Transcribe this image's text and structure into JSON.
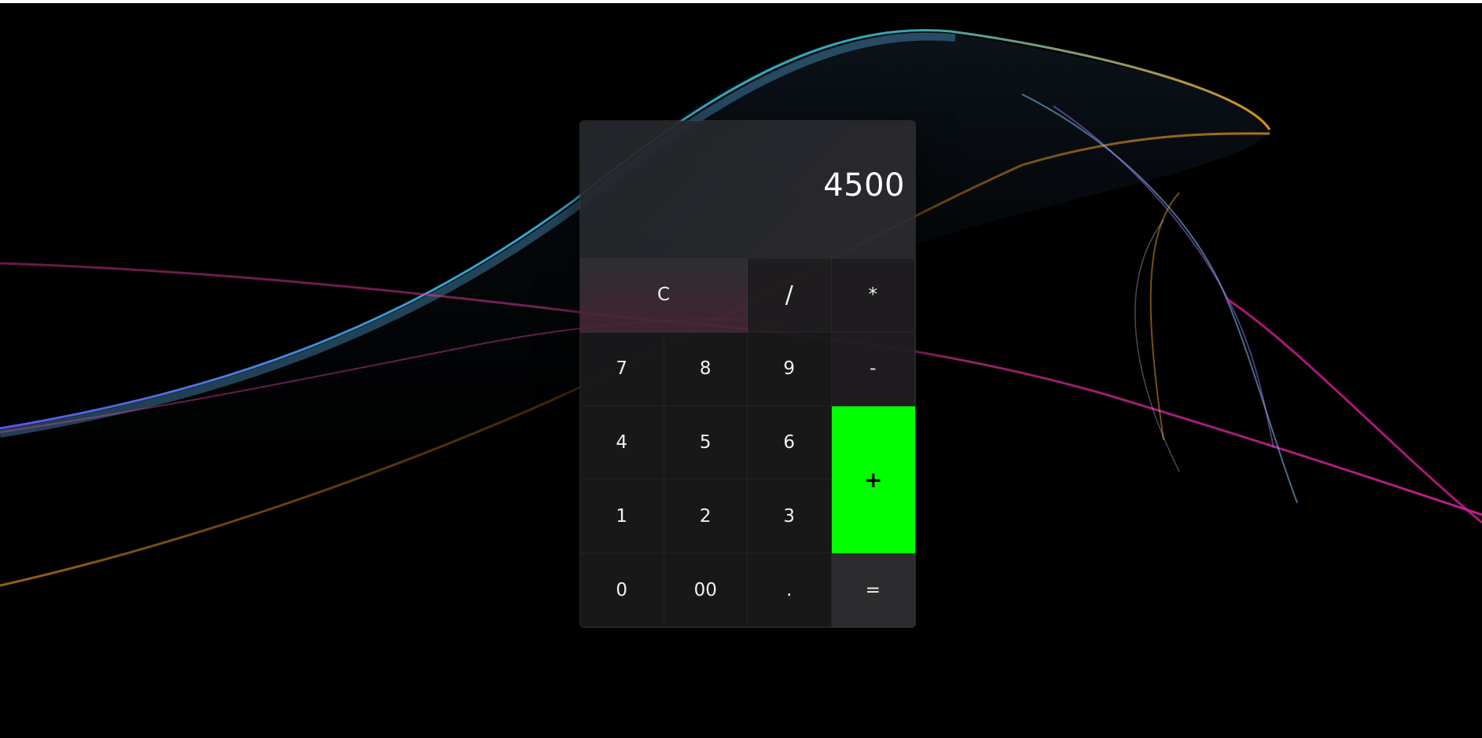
{
  "display": {
    "value": "4500"
  },
  "keys": {
    "clear": "C",
    "divide": "/",
    "multiply": "*",
    "seven": "7",
    "eight": "8",
    "nine": "9",
    "minus": "-",
    "four": "4",
    "five": "5",
    "six": "6",
    "plus": "+",
    "one": "1",
    "two": "2",
    "three": "3",
    "zero": "0",
    "double_zero": "00",
    "decimal": ".",
    "equals": "="
  },
  "colors": {
    "background": "#000000",
    "plus_key": "#00ff00",
    "key_text": "#f2f2f2"
  }
}
